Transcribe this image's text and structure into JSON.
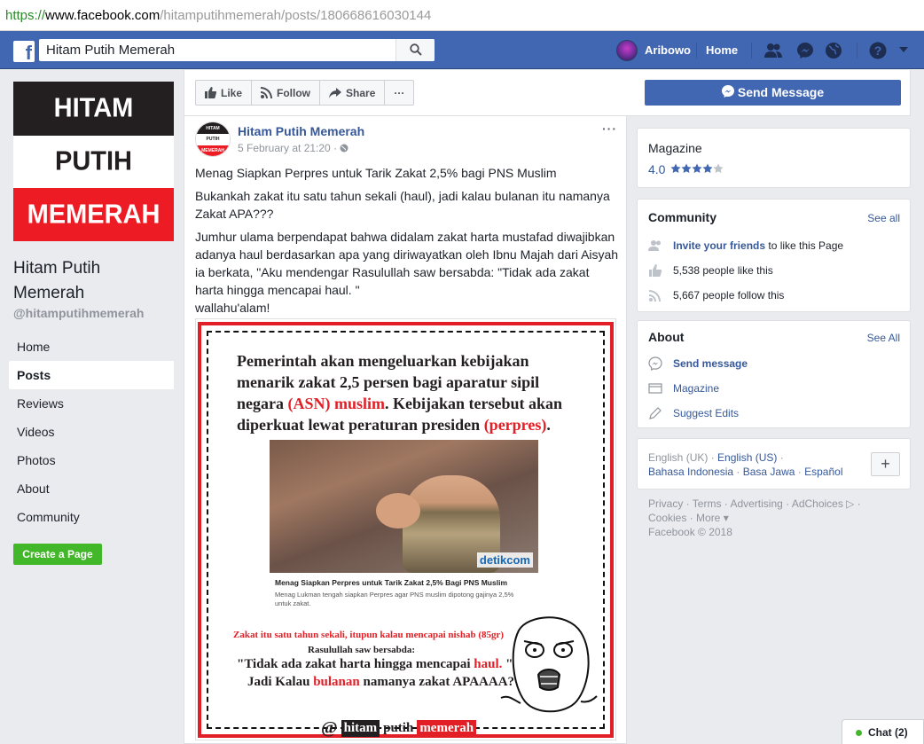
{
  "browser": {
    "url_proto": "https://",
    "url_host": "www.facebook.com",
    "url_path": "/hitamputihmemerah/posts/180668616030144"
  },
  "topbar": {
    "logo": "f",
    "search_value": "Hitam Putih Memerah",
    "user_name": "Aribowo",
    "home_label": "Home"
  },
  "cover": {
    "line1": "HITAM",
    "line2": "PUTIH",
    "line3": "MEMERAH"
  },
  "page": {
    "name": "Hitam Putih Memerah",
    "handle": "@hitamputihmemerah"
  },
  "left_nav": [
    {
      "label": "Home",
      "active": false
    },
    {
      "label": "Posts",
      "active": true
    },
    {
      "label": "Reviews",
      "active": false
    },
    {
      "label": "Videos",
      "active": false
    },
    {
      "label": "Photos",
      "active": false
    },
    {
      "label": "About",
      "active": false
    },
    {
      "label": "Community",
      "active": false
    }
  ],
  "create_page_label": "Create a Page",
  "action_bar": {
    "like": "Like",
    "follow": "Follow",
    "share": "Share",
    "more": "···",
    "send_message": "Send Message"
  },
  "post": {
    "author": "Hitam Putih Memerah",
    "time": "5 February at 21:20 ·",
    "more": "···",
    "avatar_l1": "HITAM",
    "avatar_l2": "PUTIH",
    "avatar_l3": "MEMERAH",
    "para1": "Menag Siapkan Perpres untuk Tarik Zakat 2,5% bagi PNS Muslim",
    "para2": "Bukankah zakat itu satu tahun sekali (haul), jadi kalau bulanan itu namanya Zakat APA???",
    "para3a": "Jumhur ulama berpendapat bahwa didalam zakat harta mustafad diwajibkan adanya haul berdasarkan apa yang diriwayatkan oleh Ibnu Majah dari Aisyah ia berkata, \"Aku mendengar Rasulullah saw bersabda: \"Tidak ada zakat harta hingga mencapai haul. \"",
    "para3b": "wallahu'alam!"
  },
  "post_image": {
    "headline_a": "Pemerintah akan mengeluarkan kebijakan menarik zakat 2,5 persen bagi aparatur sipil negara ",
    "headline_asn": "(ASN) muslim",
    "headline_b": ". Kebijakan tersebut akan diperkuat lewat peraturan presiden ",
    "headline_perpres": "(perpres)",
    "headline_c": ".",
    "detik_logo": "detikcom",
    "caption_title": "Menag Siapkan Perpres untuk Tarik Zakat 2,5% Bagi PNS Muslim",
    "caption_desc": "Menag Lukman tengah siapkan Perpres agar PNS muslim dipotong gajinya 2,5% untuk zakat.",
    "quote1": "Zakat itu satu tahun sekali, itupun kalau mencapai nishab (85gr)",
    "quote2": "Rasulullah saw bersabda:",
    "quote3a": "\"Tidak ada zakat harta hingga mencapai ",
    "quote3_red": "haul.",
    "quote3b": " \"",
    "quote4a": "Jadi Kalau ",
    "quote4_red": "bulanan",
    "quote4b": " namanya zakat APAAAA????",
    "footer_at": "@",
    "footer_1": "hitam",
    "footer_2": "putih",
    "footer_3": "memerah"
  },
  "right": {
    "magazine": {
      "title": "Magazine",
      "rating": "4.0",
      "stars": 4
    },
    "community": {
      "title": "Community",
      "see_all": "See all",
      "invite_link": "Invite your friends",
      "invite_rest": " to like this Page",
      "likes": "5,538 people like this",
      "follows": "5,667 people follow this"
    },
    "about": {
      "title": "About",
      "see_all": "See All",
      "send_message": "Send message",
      "category": "Magazine",
      "suggest": "Suggest Edits"
    },
    "languages": {
      "current": "English (UK)",
      "sep1": " · ",
      "l_us": "English (US)",
      "sep2": " ·",
      "l_id": "Bahasa Indonesia",
      "sep3": " · ",
      "l_jw": "Basa Jawa",
      "sep4": " · ",
      "l_es": "Español",
      "plus": "+"
    },
    "footer": {
      "line1": "Privacy · Terms · Advertising · AdChoices ▷ ·",
      "line2": "Cookies · More ▾",
      "line3": "Facebook © 2018"
    }
  },
  "chat": {
    "label": "Chat (2)"
  },
  "colors": {
    "fb_blue": "#4267b2",
    "link": "#365899",
    "red": "#e21f26",
    "green": "#42b72a"
  }
}
